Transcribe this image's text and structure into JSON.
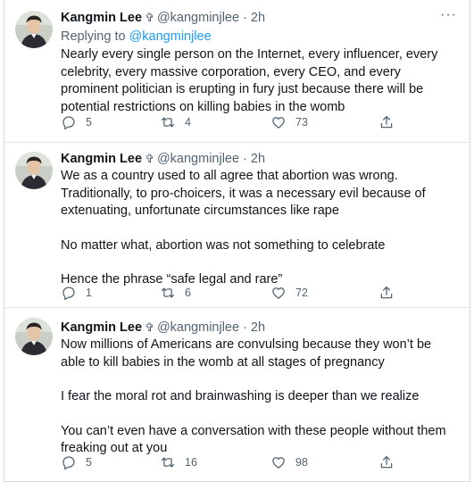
{
  "thread": [
    {
      "author": "Kangmin Lee",
      "badge": "✞",
      "handle": "@kangminjlee",
      "separator": "·",
      "time": "2h",
      "more": "···",
      "reply_prefix": "Replying to",
      "reply_handle": "@kangminjlee",
      "paragraphs": [
        "Nearly every single person on the Internet, every influencer, every celebrity, every massive corporation, every CEO, and every prominent politician is erupting in fury just because there will be potential restrictions on killing babies in the womb"
      ],
      "replies": "5",
      "retweets": "4",
      "likes": "73"
    },
    {
      "author": "Kangmin Lee",
      "badge": "✞",
      "handle": "@kangminjlee",
      "separator": "·",
      "time": "2h",
      "more": "···",
      "paragraphs": [
        "We as a country used to all agree that abortion was wrong. Traditionally, to pro-choicers, it was a necessary evil because of extenuating, unfortunate circumstances like rape",
        "No matter what, abortion was not something to celebrate",
        "Hence the phrase “safe legal and rare”"
      ],
      "replies": "1",
      "retweets": "6",
      "likes": "72"
    },
    {
      "author": "Kangmin Lee",
      "badge": "✞",
      "handle": "@kangminjlee",
      "separator": "·",
      "time": "2h",
      "more": "···",
      "paragraphs": [
        "Now millions of Americans are convulsing because they won’t be able to kill babies in the womb at all stages of pregnancy",
        "I fear the moral rot and brainwashing is deeper than we realize",
        "You can’t even have a conversation with these people without them freaking out at you"
      ],
      "replies": "5",
      "retweets": "16",
      "likes": "98"
    }
  ],
  "colors": {
    "text": "#0f1419",
    "secondary": "#536471",
    "link": "#1d9bf0",
    "divider": "#dfe5e8"
  },
  "icons": [
    "reply-icon",
    "retweet-icon",
    "like-icon",
    "share-icon",
    "more-icon"
  ]
}
